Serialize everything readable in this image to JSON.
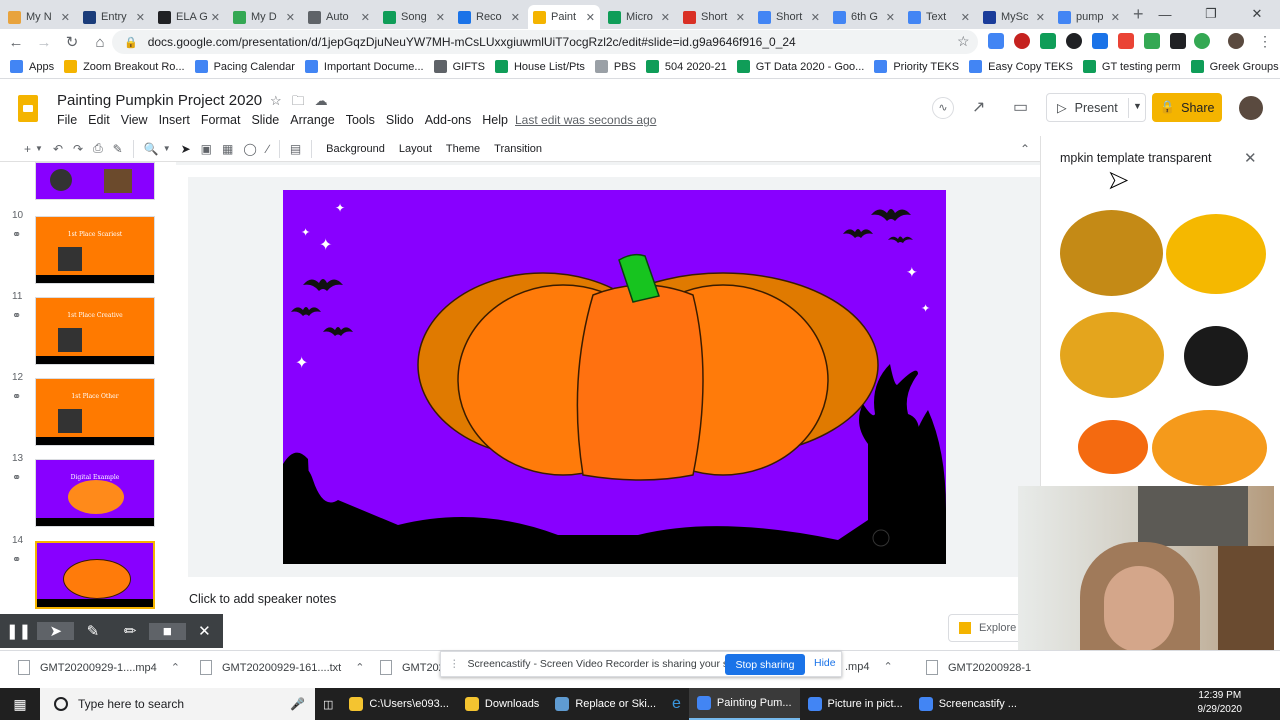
{
  "browser": {
    "tabs": [
      {
        "label": "My N",
        "color": "#e8a33d"
      },
      {
        "label": "Entry",
        "color": "#1a3c7a"
      },
      {
        "label": "ELA G",
        "color": "#202124"
      },
      {
        "label": "My D",
        "color": "#34a853"
      },
      {
        "label": "Auto",
        "color": "#5f6368"
      },
      {
        "label": "Song",
        "color": "#0f9d58"
      },
      {
        "label": "Reco",
        "color": "#1a73e8"
      },
      {
        "label": "Paint",
        "color": "#f4b400"
      },
      {
        "label": "Micro",
        "color": "#0f9d58"
      },
      {
        "label": "Short",
        "color": "#d93025"
      },
      {
        "label": "Short",
        "color": "#4285f4"
      },
      {
        "label": "6th G",
        "color": "#4285f4"
      },
      {
        "label": "Text",
        "color": "#4285f4"
      },
      {
        "label": "MySc",
        "color": "#1a3c9a"
      },
      {
        "label": "pump",
        "color": "#4285f4"
      }
    ],
    "url": "docs.google.com/presentation/d/1jepGqzDjuNeuYW7MH-mCsLUxxgiuwmlUiT7ocgRzl2c/edit#slide=id.g9a9646f916_0_24",
    "bookmarks": [
      {
        "label": "Apps",
        "color": "#4285f4"
      },
      {
        "label": "Zoom Breakout Ro...",
        "color": "#f4b400"
      },
      {
        "label": "Pacing Calendar",
        "color": "#4285f4"
      },
      {
        "label": "Important Docume...",
        "color": "#4285f4"
      },
      {
        "label": "GIFTS",
        "color": "#5f6368"
      },
      {
        "label": "House List/Pts",
        "color": "#0f9d58"
      },
      {
        "label": "PBS",
        "color": "#9aa0a6"
      },
      {
        "label": "504 2020-21",
        "color": "#0f9d58"
      },
      {
        "label": "GT Data 2020 - Goo...",
        "color": "#0f9d58"
      },
      {
        "label": "Priority TEKS",
        "color": "#4285f4"
      },
      {
        "label": "Easy Copy TEKS",
        "color": "#4285f4"
      },
      {
        "label": "GT testing perm",
        "color": "#0f9d58"
      },
      {
        "label": "Greek Groups Carp...",
        "color": "#0f9d58"
      }
    ]
  },
  "doc": {
    "title": "Painting Pumpkin Project 2020",
    "menu": [
      "File",
      "Edit",
      "View",
      "Insert",
      "Format",
      "Slide",
      "Arrange",
      "Tools",
      "Slido",
      "Add-ons",
      "Help"
    ],
    "last_edit": "Last edit was seconds ago",
    "present_label": "Present",
    "share_label": "Share",
    "toolbar": {
      "background": "Background",
      "layout": "Layout",
      "theme": "Theme",
      "transition": "Transition"
    },
    "notes_placeholder": "Click to add speaker notes"
  },
  "slides": [
    {
      "num": "10",
      "text": "1st Place Scariest"
    },
    {
      "num": "11",
      "text": "1st Place Creative"
    },
    {
      "num": "12",
      "text": "1st Place Other"
    },
    {
      "num": "13",
      "text": "Digital Example"
    },
    {
      "num": "14",
      "text": ""
    }
  ],
  "search_panel": {
    "query": "mpkin template transparent",
    "explore": "Explore"
  },
  "screencastify": {
    "message": "Screencastify - Screen Video Recorder is sharing your screen.",
    "stop": "Stop sharing",
    "hide": "Hide"
  },
  "downloads": [
    {
      "label": "GMT20200929-1....mp4"
    },
    {
      "label": "GMT20200929-161....txt"
    },
    {
      "label": "GMT202"
    },
    {
      "label": ".mp4"
    },
    {
      "label": "GMT20200928-1"
    }
  ],
  "taskbar": {
    "search_placeholder": "Type here to search",
    "items": [
      {
        "label": "C:\\Users\\e093...",
        "color": "#f4c430"
      },
      {
        "label": "Downloads",
        "color": "#f4c430"
      },
      {
        "label": "Replace or Ski...",
        "color": "#5f9bd1"
      },
      {
        "label": "Painting Pum...",
        "color": "#4285f4"
      },
      {
        "label": "Picture in pict...",
        "color": "#4285f4"
      },
      {
        "label": "Screencastify ...",
        "color": "#4285f4"
      }
    ],
    "time": "12:39 PM",
    "date": "9/29/2020"
  }
}
